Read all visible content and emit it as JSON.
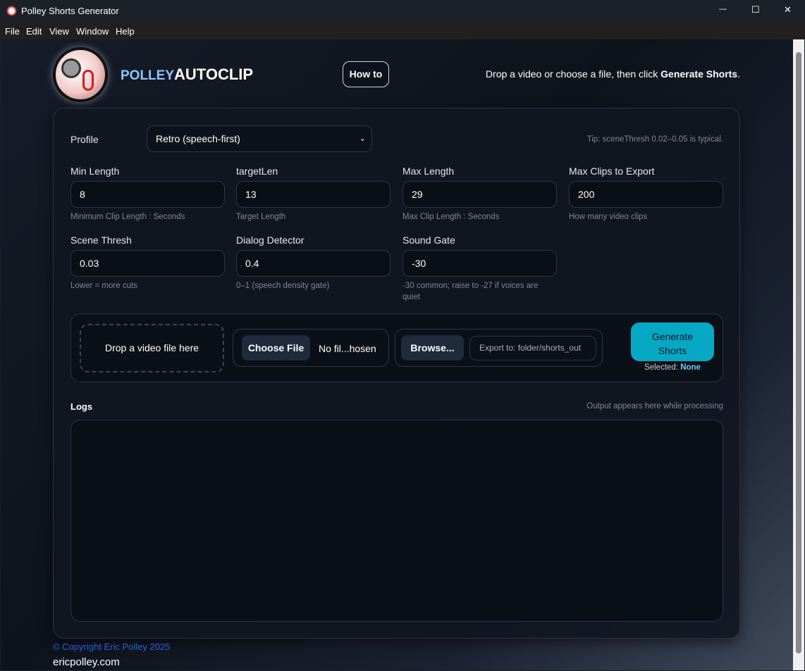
{
  "window": {
    "title": "Polley Shorts Generator",
    "minimize": "—",
    "maximize": "☐",
    "close": "✕"
  },
  "menu": [
    "File",
    "Edit",
    "View",
    "Window",
    "Help"
  ],
  "header": {
    "brand_a": "POLLEY",
    "brand_b": "AUTOCLIP",
    "howto": "How to",
    "instruction_pre": "Drop a video or choose a file, then click ",
    "instruction_bold": "Generate Shorts",
    "instruction_post": "."
  },
  "profile": {
    "label": "Profile",
    "value": "Retro (speech-first)",
    "tip": "Tip: sceneThresh 0.02–0.05 is typical."
  },
  "fields": [
    {
      "label": "Min Length",
      "value": "8",
      "hint": "Minimum Clip Length : Seconds"
    },
    {
      "label": "targetLen",
      "value": "13",
      "hint": "Target Length"
    },
    {
      "label": "Max Length",
      "value": "29",
      "hint": "Max Clip Length : Seconds"
    },
    {
      "label": "Max Clips to Export",
      "value": "200",
      "hint": "How many video clips"
    },
    {
      "label": "Scene Thresh",
      "value": "0.03",
      "hint": "Lower = more cuts"
    },
    {
      "label": "Dialog Detector",
      "value": "0.4",
      "hint": "0–1 (speech density gate)"
    },
    {
      "label": "Sound Gate",
      "value": "-30",
      "hint": "-30 common; raise to -27 if voices are quiet"
    }
  ],
  "actions": {
    "drop": "Drop a video file here",
    "choose": "Choose File",
    "no_file": "No fil...hosen",
    "browse": "Browse...",
    "export_placeholder": "Export to: folder/shorts_out",
    "generate": "Generate Shorts",
    "selected_label": "Selected: ",
    "selected_value": "None"
  },
  "logs": {
    "title": "Logs",
    "note": "Output appears here while processing",
    "content": ""
  },
  "footer": {
    "copyright": "© Copyright Eric Polley 2025",
    "site": "ericpolley.com"
  },
  "colors": {
    "accent": "#06a8c4",
    "brand_blue": "#8ec5ff",
    "copyright": "#2b5fd9"
  }
}
